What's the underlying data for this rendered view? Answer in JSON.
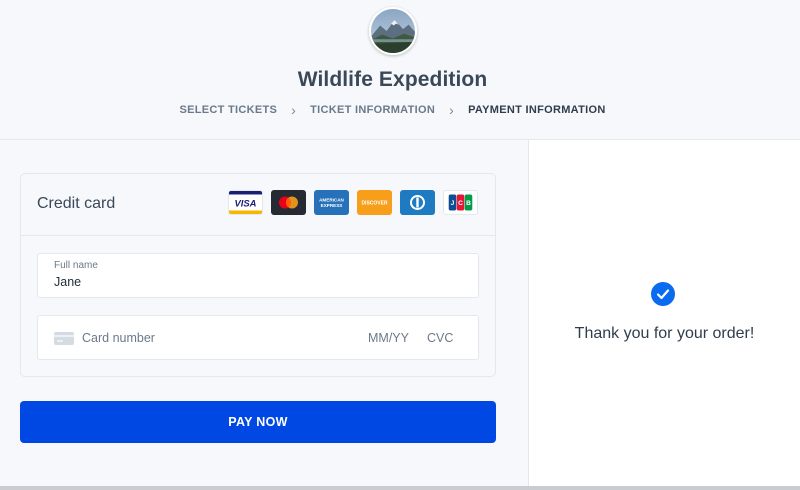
{
  "header": {
    "title": "Wildlife Expedition",
    "avatar_icon": "mountain-landscape-image",
    "steps": [
      {
        "label": "SELECT TICKETS",
        "active": false
      },
      {
        "label": "TICKET INFORMATION",
        "active": false
      },
      {
        "label": "PAYMENT INFORMATION",
        "active": true
      }
    ],
    "separator": "›"
  },
  "payment": {
    "method_title": "Credit card",
    "card_logos": [
      {
        "name": "VISA",
        "color": "#ffffff"
      },
      {
        "name": "Mastercard",
        "color": "#1a1f71"
      },
      {
        "name": "AMERICAN EXPRESS",
        "color": "#2671b9"
      },
      {
        "name": "DISCOVER",
        "color": "#f79e1b"
      },
      {
        "name": "Diners Club",
        "color": "#1e7ac1"
      },
      {
        "name": "JCB",
        "color": "#ffffff"
      }
    ],
    "full_name": {
      "label": "Full name",
      "value": "Jane"
    },
    "card_number": {
      "placeholder": "Card number",
      "expiry_placeholder": "MM/YY",
      "cvc_placeholder": "CVC"
    },
    "pay_button": "PAY NOW",
    "accent_color": "#0048e3"
  },
  "confirmation": {
    "icon": "check-icon",
    "message": "Thank you for your order!"
  }
}
